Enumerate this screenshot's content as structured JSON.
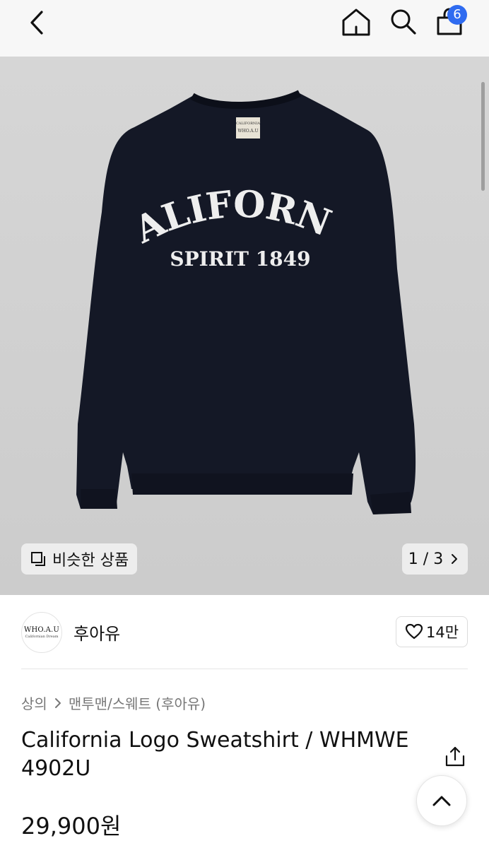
{
  "header": {
    "back_icon": "chevron-left-icon",
    "home_icon": "home-icon",
    "search_icon": "search-icon",
    "cart_icon": "shopping-bag-icon",
    "cart_count": "6",
    "badge_color": "#2f6bf0"
  },
  "gallery": {
    "similar_label": "비슷한 상품",
    "pager": "1 / 3",
    "print_line1": "CALIFORNIA",
    "print_line2": "SPIRIT 1849",
    "tag_line1": "CALIFORNIA",
    "tag_line2": "WHO.A.U",
    "sweater_color": "#141826"
  },
  "brand": {
    "logo_line1": "WHO.A.U",
    "logo_line2": "Californian Dream",
    "name": "후아유",
    "likes": "14만"
  },
  "product": {
    "breadcrumb": [
      "상의",
      "맨투맨/스웨트 (후아유)"
    ],
    "title": "California Logo Sweatshirt / WHMWE 4902U",
    "price": "29,900원"
  }
}
